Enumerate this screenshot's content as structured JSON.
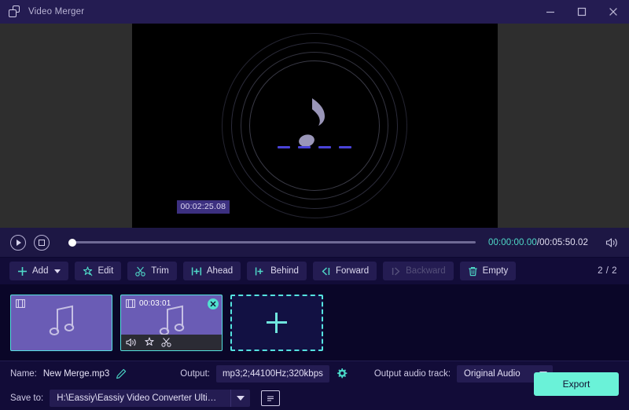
{
  "titlebar": {
    "app_name": "Video Merger",
    "logo_icon": "window-stack-icon",
    "minimize_icon": "minimize-icon",
    "maximize_icon": "maximize-icon",
    "close_icon": "close-icon"
  },
  "preview": {
    "media_icon": "music-note-icon",
    "timestamp_overlay": "00:02:25.08",
    "background_color": "#2e2e2e",
    "video_color": "#000000",
    "dash_color": "#4a43d8"
  },
  "transport": {
    "play_label": "play",
    "stop_label": "stop",
    "progress_percent": 0,
    "current_time": "00:00:00.00",
    "separator": "/",
    "total_time": "00:05:50.02",
    "volume_icon": "speaker-icon",
    "current_time_color": "#4fd9c8"
  },
  "toolbar": {
    "buttons": [
      {
        "label": "Add",
        "icon": "plus-icon",
        "disabled": false,
        "has_caret": true
      },
      {
        "label": "Edit",
        "icon": "magic-wand-icon",
        "disabled": false,
        "has_caret": false
      },
      {
        "label": "Trim",
        "icon": "scissors-icon",
        "disabled": false,
        "has_caret": false
      },
      {
        "label": "Ahead",
        "icon": "insert-ahead-icon",
        "disabled": false,
        "has_caret": false
      },
      {
        "label": "Behind",
        "icon": "insert-behind-icon",
        "disabled": false,
        "has_caret": false
      },
      {
        "label": "Forward",
        "icon": "move-forward-icon",
        "disabled": false,
        "has_caret": false
      },
      {
        "label": "Backward",
        "icon": "move-backward-icon",
        "disabled": true,
        "has_caret": false
      },
      {
        "label": "Empty",
        "icon": "trash-icon",
        "disabled": false,
        "has_caret": false
      }
    ],
    "page_counter": "2 / 2",
    "accent_color": "#4fd9c8"
  },
  "track": {
    "clips": [
      {
        "film_icon": "film-strip-icon",
        "duration": "",
        "thumb_icon": "music-note-icon",
        "selected": true,
        "show_close": false,
        "show_toolbar": false
      },
      {
        "film_icon": "film-strip-icon",
        "duration": "00:03:01",
        "thumb_icon": "music-note-icon",
        "selected": true,
        "show_close": true,
        "show_toolbar": true,
        "close_icon": "close-circle-icon",
        "actions": [
          {
            "icon": "volume-icon"
          },
          {
            "icon": "effects-icon"
          },
          {
            "icon": "scissors-icon"
          }
        ]
      }
    ],
    "add_tile": {
      "icon": "plus-icon",
      "label": ""
    }
  },
  "bottom": {
    "name_label": "Name:",
    "name_value": "New Merge.mp3",
    "edit_icon": "pencil-icon",
    "output_label": "Output:",
    "output_value": "mp3;2;44100Hz;320kbps",
    "settings_icon": "gear-icon",
    "audio_track_label": "Output audio track:",
    "audio_track_value": "Original Audio",
    "save_to_label": "Save to:",
    "save_to_value": "H:\\Eassiy\\Eassiy Video Converter Ultimate\\Merger",
    "folder_icon": "folder-open-icon",
    "export_label": "Export",
    "export_color": "#6af2d8"
  }
}
